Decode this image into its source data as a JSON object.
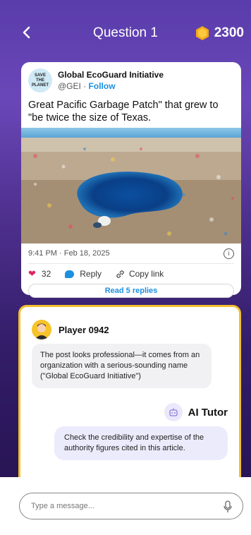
{
  "header": {
    "back_label": "<",
    "title": "Question 1",
    "coins": "2300",
    "coin_icon": "gem-icon"
  },
  "tweet": {
    "logo_text_top": "SAVE",
    "logo_text_mid": "THE",
    "logo_text_bottom": "PLANET",
    "account_name": "Global EcoGuard Initiative",
    "handle": "@GEI",
    "separator": "·",
    "follow_label": "Follow",
    "text": "Great Pacific Garbage Patch\" that grew to \"be twice the size of Texas.",
    "timestamp": "9:41 PM · Feb 18, 2025",
    "likes": "32",
    "reply_label": "Reply",
    "copy_link_label": "Copy link",
    "read_replies_label": "Read 5 replies"
  },
  "chat": {
    "player_name": "Player 0942",
    "player_message": "The post looks professional—it comes from an organization with a serious-sounding name (\"Global EcoGuard Initiative\")",
    "tutor_name": "AI Tutor",
    "tutor_message": "Check the credibility and expertise of the authority figures cited in this article."
  },
  "composer": {
    "placeholder": "Type a message..."
  },
  "colors": {
    "accent_purple": "#5a3cab",
    "panel_border": "#f3c02d",
    "link_blue": "#1d8fe0",
    "heart_red": "#e0245e"
  }
}
